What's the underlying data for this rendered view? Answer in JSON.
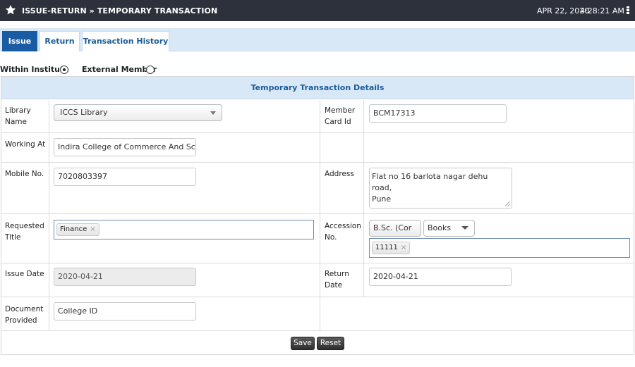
{
  "topbar": {
    "title": "ISSUE-RETURN » TEMPORARY TRANSACTION",
    "date": "APR 22, 2020",
    "time": "4:28:21 AM"
  },
  "tabs": [
    {
      "label": "Issue",
      "active": true
    },
    {
      "label": "Return",
      "active": false
    },
    {
      "label": "Transaction History",
      "active": false
    }
  ],
  "member_type": {
    "options": [
      {
        "label": "Within Institute",
        "selected": true
      },
      {
        "label": "External Member",
        "selected": false
      }
    ]
  },
  "panel": {
    "heading": "Temporary Transaction Details"
  },
  "form": {
    "library_name": {
      "label_1": "Library",
      "label_2": "Name",
      "value": "ICCS Library"
    },
    "member_card_id": {
      "label_1": "Member",
      "label_2": "Card Id",
      "value": "BCM17313"
    },
    "working_at": {
      "label": "Working At",
      "value": "Indira College of Commerce And Scien"
    },
    "mobile_no": {
      "label": "Mobile No.",
      "value": "7020803397"
    },
    "address": {
      "label": "Address",
      "line_1": "Flat no 16 barlota nagar dehu road,",
      "line_2": "Pune"
    },
    "requested_title": {
      "label_1": "Requested",
      "label_2": "Title",
      "tag": "Finance",
      "tag_remove": "×"
    },
    "accession_no": {
      "label_1": "Accession",
      "label_2": "No.",
      "course_select": "B.Sc. (Cor",
      "type_select": "Books",
      "tag": "11111",
      "tag_remove": "×"
    },
    "issue_date": {
      "label": "Issue Date",
      "value": "2020-04-21"
    },
    "return_date": {
      "label_1": "Return",
      "label_2": "Date",
      "value": "2020-04-21"
    },
    "document_provided": {
      "label_1": "Document",
      "label_2": "Provided",
      "value": "College ID"
    }
  },
  "actions": {
    "save": "Save",
    "reset": "Reset"
  },
  "icons": {
    "title_icon": "star-icon",
    "menu_icon": "kebab-menu-icon"
  },
  "colors": {
    "topbar": "#2c313c",
    "active_tab": "#1a5ca4",
    "tab_text": "#1c5d9a",
    "header_band": "#d9e8f7"
  }
}
